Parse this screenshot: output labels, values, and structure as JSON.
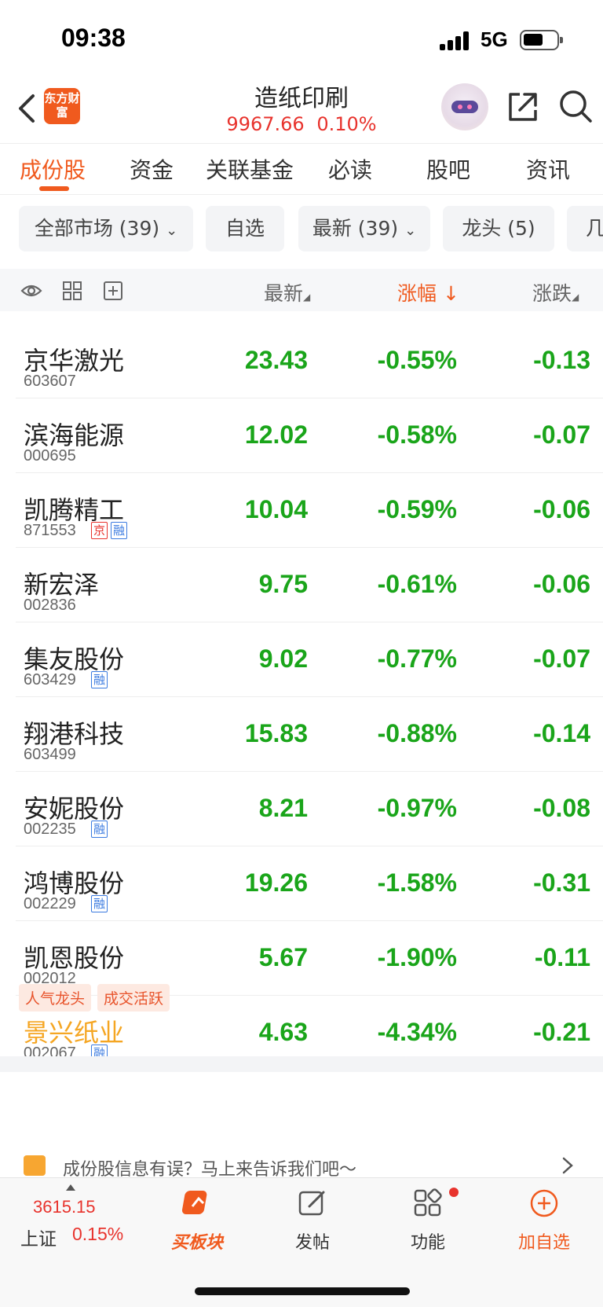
{
  "status": {
    "time": "09:38",
    "network": "5G"
  },
  "header": {
    "logo_text": "东方财富",
    "title": "造纸印刷",
    "index_value": "9967.66",
    "index_change": "0.10%"
  },
  "tabs": [
    {
      "label": "成份股",
      "active": true
    },
    {
      "label": "资金"
    },
    {
      "label": "关联基金"
    },
    {
      "label": "必读"
    },
    {
      "label": "股吧"
    },
    {
      "label": "资讯"
    }
  ],
  "filters": [
    {
      "label": "全部市场 (39)"
    },
    {
      "label": "自选"
    },
    {
      "label": "最新 (39)"
    },
    {
      "label": "龙头 (5)"
    },
    {
      "label": "几"
    }
  ],
  "columns": {
    "latest": "最新",
    "change_pct": "涨幅",
    "change": "涨跌"
  },
  "stocks": [
    {
      "name": "京华激光",
      "code": "603607",
      "price": "23.43",
      "pct": "-0.55%",
      "chg": "-0.13",
      "badges": []
    },
    {
      "name": "滨海能源",
      "code": "000695",
      "price": "12.02",
      "pct": "-0.58%",
      "chg": "-0.07",
      "badges": []
    },
    {
      "name": "凯腾精工",
      "code": "871553",
      "price": "10.04",
      "pct": "-0.59%",
      "chg": "-0.06",
      "badges": [
        "京",
        "融"
      ]
    },
    {
      "name": "新宏泽",
      "code": "002836",
      "price": "9.75",
      "pct": "-0.61%",
      "chg": "-0.06",
      "badges": []
    },
    {
      "name": "集友股份",
      "code": "603429",
      "price": "9.02",
      "pct": "-0.77%",
      "chg": "-0.07",
      "badges": [
        "融"
      ]
    },
    {
      "name": "翔港科技",
      "code": "603499",
      "price": "15.83",
      "pct": "-0.88%",
      "chg": "-0.14",
      "badges": []
    },
    {
      "name": "安妮股份",
      "code": "002235",
      "price": "8.21",
      "pct": "-0.97%",
      "chg": "-0.08",
      "badges": [
        "融"
      ]
    },
    {
      "name": "鸿博股份",
      "code": "002229",
      "price": "19.26",
      "pct": "-1.58%",
      "chg": "-0.31",
      "badges": [
        "融"
      ]
    },
    {
      "name": "凯恩股份",
      "code": "002012",
      "price": "5.67",
      "pct": "-1.90%",
      "chg": "-0.11",
      "badges": []
    },
    {
      "name": "景兴纸业",
      "code": "002067",
      "price": "4.63",
      "pct": "-4.34%",
      "chg": "-0.21",
      "badges": [
        "融"
      ],
      "highlight": true
    }
  ],
  "tags": [
    "人气龙头",
    "成交活跃"
  ],
  "feedback_text": "成份股信息有误？马上来告诉我们吧～",
  "bottom": {
    "index_value": "3615.15",
    "index_name": "上证",
    "index_pct": "0.15%",
    "buy_block": "买板块",
    "post": "发帖",
    "functions": "功能",
    "add_watch": "加自选"
  },
  "colors": {
    "accent": "#f05a1e",
    "down": "#1aa51a",
    "up": "#e8332d",
    "highlight": "#f5a623"
  }
}
